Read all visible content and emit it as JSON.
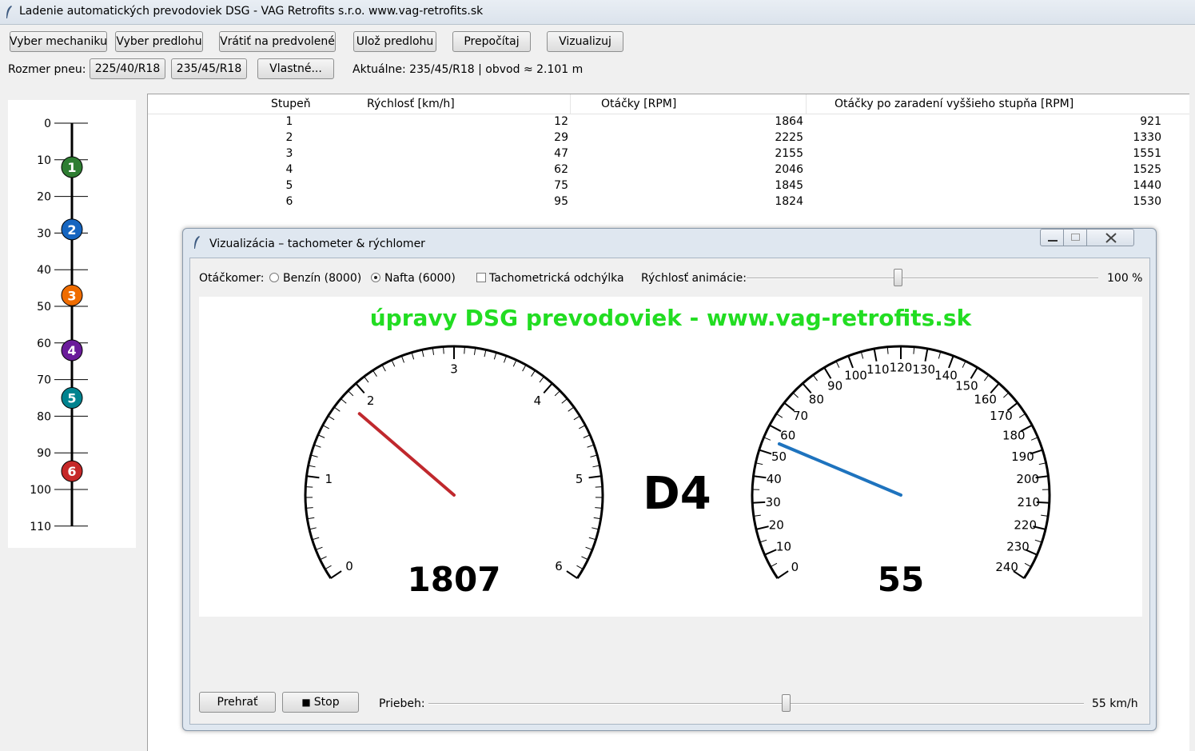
{
  "window": {
    "title": "Ladenie automatických prevodoviek DSG - VAG Retrofits s.r.o. www.vag-retrofits.sk"
  },
  "toolbar": {
    "buttons": [
      "Vyber mechaniku",
      "Vyber predlohu",
      "Vrátiť na predvolené",
      "Ulož predlohu",
      "Prepočítaj",
      "Vizualizuj"
    ]
  },
  "tyre": {
    "label": "Rozmer pneu:",
    "options": [
      "225/40/R18",
      "235/45/R18",
      "Vlastné..."
    ],
    "current": "Aktuálne: 235/45/R18  | obvod ≈ 2.101 m"
  },
  "ladder": {
    "scale": [
      "0",
      "10",
      "20",
      "30",
      "40",
      "50",
      "60",
      "70",
      "80",
      "90",
      "100",
      "110"
    ],
    "gears": [
      {
        "label": "1",
        "speed": 12,
        "color": "#2e7d32"
      },
      {
        "label": "2",
        "speed": 29,
        "color": "#1565c0"
      },
      {
        "label": "3",
        "speed": 47,
        "color": "#ef6c00"
      },
      {
        "label": "4",
        "speed": 62,
        "color": "#6a1b9a"
      },
      {
        "label": "5",
        "speed": 75,
        "color": "#00838f"
      },
      {
        "label": "6",
        "speed": 95,
        "color": "#c62828"
      }
    ]
  },
  "table": {
    "headers": [
      "Stupeň",
      "Rýchlosť [km/h]",
      "Otáčky [RPM]",
      "Otáčky po zaradení vyššieho stupňa [RPM]"
    ],
    "rows": [
      [
        "1",
        "12",
        "1864",
        "921"
      ],
      [
        "2",
        "29",
        "2225",
        "1330"
      ],
      [
        "3",
        "47",
        "2155",
        "1551"
      ],
      [
        "4",
        "62",
        "2046",
        "1525"
      ],
      [
        "5",
        "75",
        "1845",
        "1440"
      ],
      [
        "6",
        "95",
        "1824",
        "1530"
      ]
    ]
  },
  "viz": {
    "title": "Vizualizácia – tachometer & rýchlomer",
    "rpm_label": "Otáčkomer:",
    "radio_petrol": "Benzín (8000)",
    "radio_diesel": "Nafta (6000)",
    "checkbox": "Tachometrická odchýlka",
    "anim_label": "Rýchlosť animácie:",
    "anim_value": "100 %",
    "anim_level": 0.43,
    "banner": "úpravy DSG prevodoviek - www.vag-retrofits.sk",
    "banner_color": "#22dd22",
    "gear": "D4",
    "rpm_value": "1807",
    "rpm_max": 6000,
    "rpm_labels": [
      "0",
      "1",
      "2",
      "3",
      "4",
      "5",
      "6"
    ],
    "needle_rpm_color": "#c0282d",
    "speed_value": "55",
    "speed_max": 240,
    "speed_labels": [
      "0",
      "10",
      "20",
      "30",
      "40",
      "50",
      "60",
      "70",
      "80",
      "90",
      "100",
      "110",
      "120",
      "130",
      "140",
      "150",
      "160",
      "170",
      "180",
      "190",
      "200",
      "210",
      "220",
      "230",
      "240"
    ],
    "needle_speed_color": "#1e73be",
    "play": "Prehrať",
    "stop": "Stop",
    "stop_icon": "■",
    "progress_label": "Priebeh:",
    "progress_value": "55 km/h",
    "progress_level": 0.545
  }
}
